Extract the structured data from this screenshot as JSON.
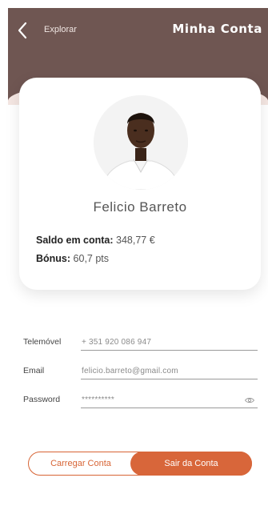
{
  "header": {
    "back_label": "Explorar",
    "title": "Minha Conta"
  },
  "profile": {
    "name": "Felicio Barreto",
    "balance_label": "Saldo em conta:",
    "balance_value": "348,77 €",
    "bonus_label": "Bónus:",
    "bonus_value": "60,7 pts"
  },
  "form": {
    "phone": {
      "label": "Telemóvel",
      "value": "+ 351 920 086 947"
    },
    "email": {
      "label": "Email",
      "value": "felicio.barreto@gmail.com"
    },
    "password": {
      "label": "Password",
      "value": "**********"
    }
  },
  "actions": {
    "load_label": "Carregar Conta",
    "logout_label": "Sair da Conta"
  },
  "colors": {
    "header_bg": "#6f5652",
    "accent": "#d8663a",
    "band_light": "#f4e6e2"
  },
  "icons": {
    "back": "chevron-left-icon",
    "password_toggle": "eye-icon"
  }
}
